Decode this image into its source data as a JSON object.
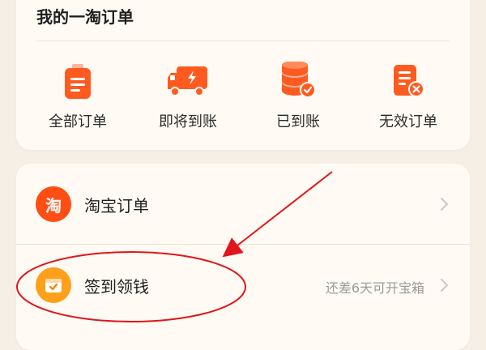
{
  "orders": {
    "title": "我的一淘订单",
    "items": [
      {
        "label": "全部订单",
        "icon": "clipboard-icon"
      },
      {
        "label": "即将到账",
        "icon": "truck-icon"
      },
      {
        "label": "已到账",
        "icon": "coins-check-icon"
      },
      {
        "label": "无效订单",
        "icon": "document-cancel-icon"
      }
    ]
  },
  "list": {
    "rows": [
      {
        "label": "淘宝订单",
        "icon": "taobao-icon",
        "icon_text": "淘",
        "extra": ""
      },
      {
        "label": "签到领钱",
        "icon": "calendar-check-icon",
        "extra": "还差6天可开宝箱"
      }
    ]
  },
  "colors": {
    "accent": "#ff5a1f",
    "annotation_red": "#e0161b",
    "background": "#f5efe6",
    "card": "#fffbf4"
  }
}
